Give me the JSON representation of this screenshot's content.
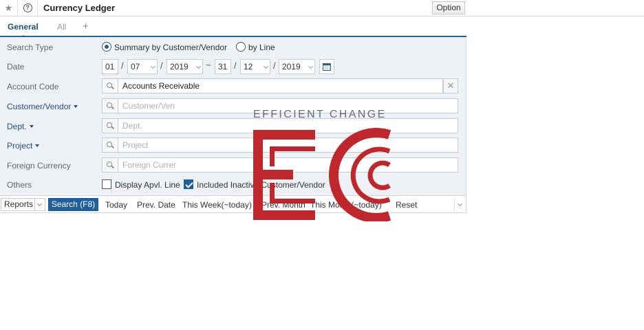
{
  "header": {
    "title": "Currency Ledger",
    "option_label": "Option"
  },
  "tabs": [
    {
      "label": "General",
      "active": true
    },
    {
      "label": "All",
      "active": false
    },
    {
      "label": "+",
      "active": false
    }
  ],
  "form": {
    "search_type": {
      "label": "Search Type",
      "options": [
        "Summary by Customer/Vendor",
        "by Line"
      ],
      "selected": "Summary by Customer/Vendor"
    },
    "date": {
      "label": "Date",
      "from": {
        "day": "01",
        "month": "07",
        "year": "2019"
      },
      "to": {
        "day": "31",
        "month": "12",
        "year": "2019"
      },
      "separator": "/",
      "range_separator": "~"
    },
    "account_code": {
      "label": "Account Code",
      "value": "Accounts Receivable"
    },
    "customer_vendor": {
      "label": "Customer/Vendor",
      "placeholder": "Customer/Ven"
    },
    "dept": {
      "label": "Dept.",
      "placeholder": "Dept."
    },
    "project": {
      "label": "Project",
      "placeholder": "Project"
    },
    "foreign_currency": {
      "label": "Foreign Currency",
      "placeholder": "Foreign Currer"
    },
    "others": {
      "label": "Others",
      "display_apvl_line": {
        "label": "Display Apvl. Line",
        "checked": false
      },
      "included_inactive": {
        "label": "Included Inactive Customer/Vendor",
        "checked": true
      }
    }
  },
  "toolbar": {
    "reports_label": "Reports",
    "search_label": "Search (F8)",
    "links": [
      "Today",
      "Prev. Date",
      "This Week(~today)",
      "Prev. Month",
      "This Month(~today)",
      "Reset"
    ]
  },
  "watermark": {
    "text": "EFFICIENT CHANGE",
    "color": "#c0272d"
  },
  "colors": {
    "accent": "#1f5f9f",
    "panel_bg": "#eef1f5"
  }
}
